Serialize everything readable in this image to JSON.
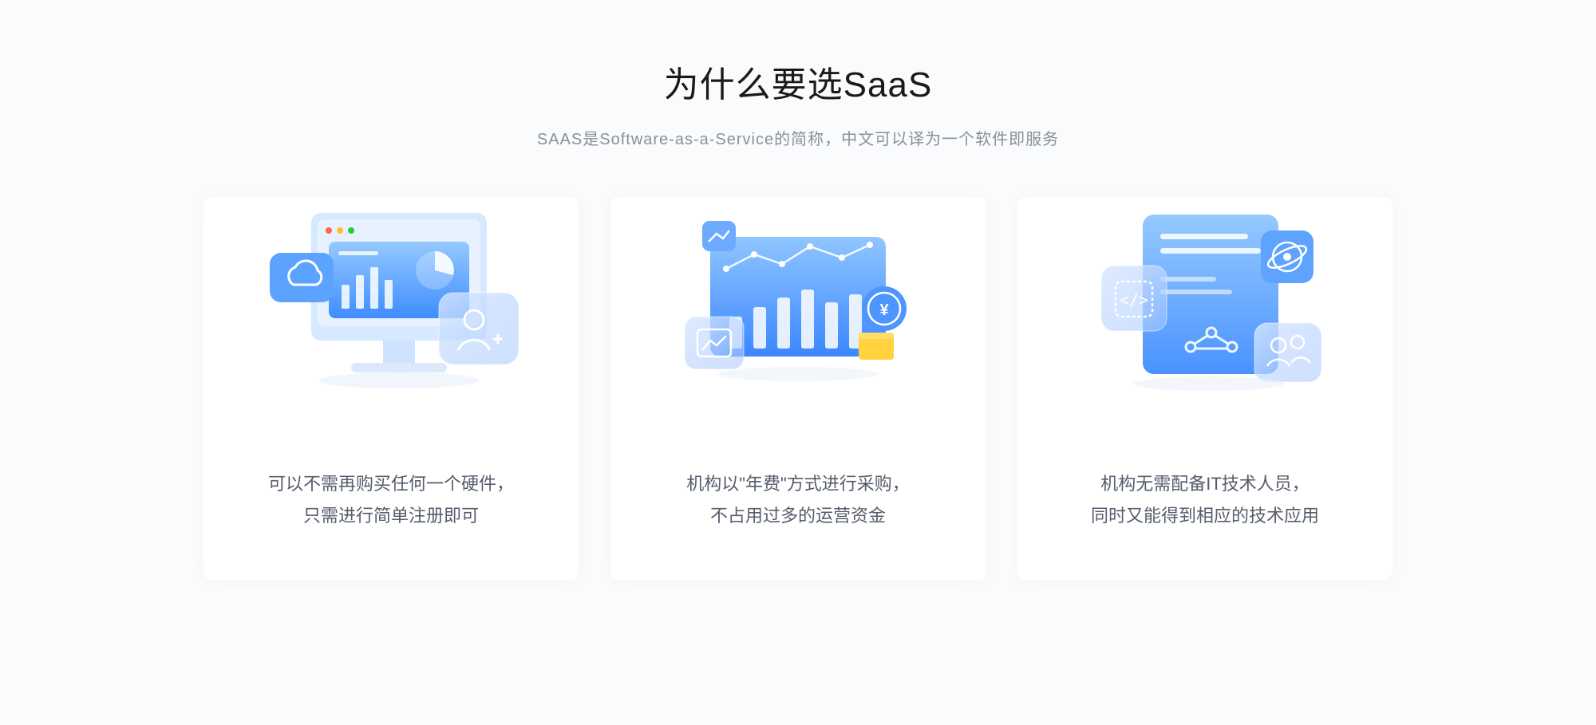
{
  "header": {
    "title": "为什么要选SaaS",
    "subtitle": "SAAS是Software-as-a-Service的简称，中文可以译为一个软件即服务"
  },
  "cards": [
    {
      "desc_line1": "可以不需再购买任何一个硬件，",
      "desc_line2": "只需进行简单注册即可"
    },
    {
      "desc_line1": "机构以\"年费\"方式进行采购，",
      "desc_line2": "不占用过多的运营资金"
    },
    {
      "desc_line1": "机构无需配备IT技术人员，",
      "desc_line2": "同时又能得到相应的技术应用"
    }
  ]
}
